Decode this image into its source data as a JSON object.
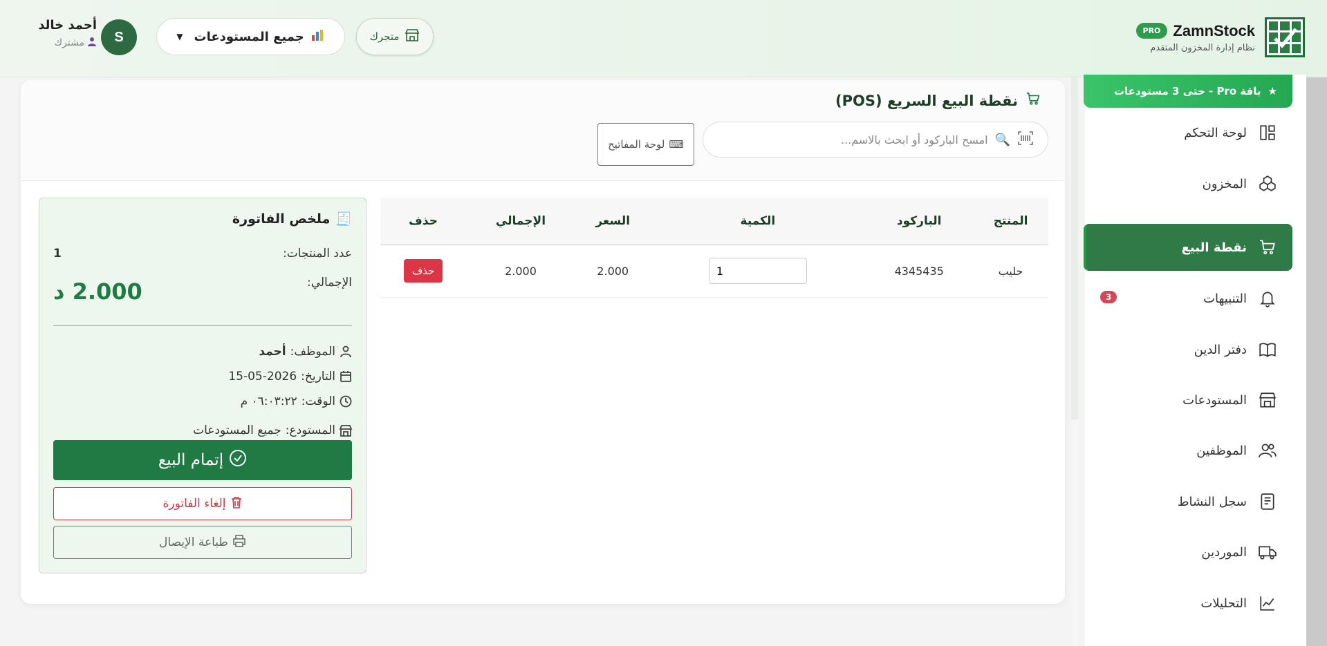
{
  "header": {
    "brand_name": "ZamnStock",
    "pro_badge": "PRO",
    "brand_subtitle": "نظام إدارة المخزون المتقدم",
    "store_button": "متجرك",
    "warehouse_select": "جميع المستودعات",
    "avatar_letter": "S",
    "user_name": "أحمد خالد",
    "user_role": "مشترك"
  },
  "sidebar": {
    "pro_banner": "باقة Pro - حتى 3 مستودعات",
    "items": [
      {
        "label": "لوحة التحكم",
        "icon": "dashboard-icon"
      },
      {
        "label": "المخزون",
        "icon": "boxes-icon"
      },
      {
        "label": "نقطة البيع",
        "icon": "cart-icon",
        "active": true
      },
      {
        "label": "التنبيهات",
        "icon": "bell-icon",
        "badge": "3"
      },
      {
        "label": "دفتر الدين",
        "icon": "book-icon"
      },
      {
        "label": "المستودعات",
        "icon": "warehouse-icon"
      },
      {
        "label": "الموظفين",
        "icon": "users-icon"
      },
      {
        "label": "سجل النشاط",
        "icon": "activity-log-icon"
      },
      {
        "label": "الموردين",
        "icon": "truck-icon"
      },
      {
        "label": "التحليلات",
        "icon": "chart-line-icon"
      }
    ]
  },
  "pos": {
    "title": "نقطة البيع السريع (POS)",
    "search_placeholder": "امسح الباركود أو ابحث بالاسم...",
    "keyboard_button": "لوحة المفاتيح",
    "table": {
      "headers": [
        "المنتج",
        "الباركود",
        "الكمية",
        "السعر",
        "الإجمالي",
        "حذف"
      ],
      "rows": [
        {
          "product": "حليب",
          "barcode": "4345435",
          "quantity": "1",
          "price": "2.000",
          "total": "2.000",
          "delete_label": "حذف"
        }
      ]
    }
  },
  "summary": {
    "title": "ملخص الفاتورة",
    "count_label": "عدد المنتجات:",
    "count_value": "1",
    "total_label": "الإجمالي:",
    "total_value": "2.000 د",
    "employee_label": "الموظف:",
    "employee_value": "أحمد",
    "date_label": "التاريخ:",
    "date_value": "15-05-2026",
    "time_label": "الوقت:",
    "time_value": "٠٦:٠٣:٢٢ م",
    "warehouse_label": "المستودع:",
    "warehouse_value": "جميع المستودعات",
    "complete_button": "إتمام البيع",
    "cancel_button": "إلغاء الفاتورة",
    "print_button": "طباعة الإيصال"
  },
  "colors": {
    "primary": "#1f7a43",
    "danger": "#dc3545",
    "pro_green": "#2f9b4f"
  }
}
